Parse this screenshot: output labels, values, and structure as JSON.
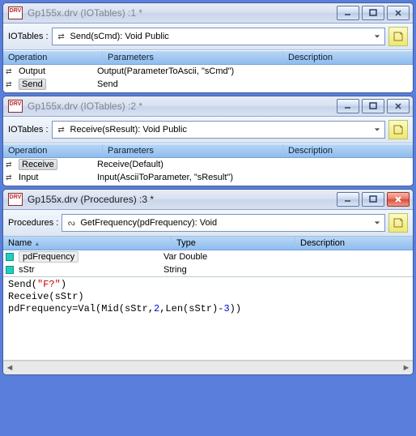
{
  "win1": {
    "title": "Gp155x.drv (IOTables) :1 *",
    "toolbar_label": "IOTables :",
    "dropdown": "Send(sCmd): Void Public",
    "cols": {
      "op": "Operation",
      "pa": "Parameters",
      "de": "Description"
    },
    "rows": [
      {
        "op": "Output",
        "pa": "Output(ParameterToAscii, \"sCmd\")",
        "sel": false
      },
      {
        "op": "Send",
        "pa": "Send",
        "sel": true
      }
    ]
  },
  "win2": {
    "title": "Gp155x.drv (IOTables) :2 *",
    "toolbar_label": "IOTables :",
    "dropdown": "Receive(sResult): Void Public",
    "cols": {
      "op": "Operation",
      "pa": "Parameters",
      "de": "Description"
    },
    "rows": [
      {
        "op": "Receive",
        "pa": "Receive(Default)",
        "sel": true
      },
      {
        "op": "Input",
        "pa": "Input(AsciiToParameter, \"sResult\")",
        "sel": false
      }
    ]
  },
  "win3": {
    "title": "Gp155x.drv (Procedures) :3 *",
    "toolbar_label": "Procedures :",
    "dropdown": "GetFrequency(pdFrequency): Void",
    "cols": {
      "name": "Name",
      "type": "Type",
      "desc": "Description"
    },
    "vars": [
      {
        "name": "pdFrequency",
        "type": "Var Double",
        "sel": true
      },
      {
        "name": "sStr",
        "type": "String",
        "sel": false
      }
    ],
    "code": {
      "l1a": "Send(",
      "l1s": "\"F?\"",
      "l1b": ")",
      "l2": "Receive(sStr)",
      "l3a": "pdFrequency=Val(Mid(sStr,",
      "l3n1": "2",
      "l3b": ",Len(sStr)-",
      "l3n2": "3",
      "l3c": "))"
    }
  }
}
